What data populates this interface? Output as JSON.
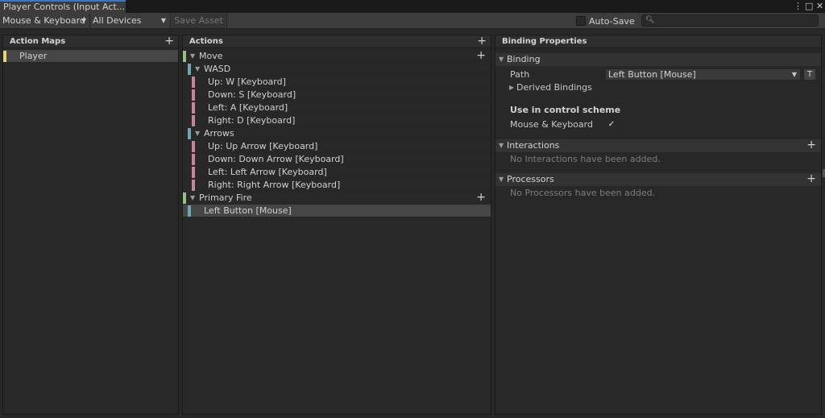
{
  "window": {
    "title": "Player Controls (Input Act...",
    "controls": [
      "⋮",
      "□",
      "✕"
    ]
  },
  "toolbar": {
    "control_scheme": "Mouse & Keyboard",
    "devices": "All Devices",
    "save_asset": "Save Asset",
    "auto_save_label": "Auto-Save",
    "search_placeholder": ""
  },
  "action_maps": {
    "header": "Action Maps",
    "items": [
      {
        "label": "Player",
        "color": "#e6d473"
      }
    ]
  },
  "actions": {
    "header": "Actions",
    "rows": [
      {
        "label": "Move",
        "kind": "action",
        "bar": "green",
        "expanded": true,
        "add": true
      },
      {
        "label": "WASD",
        "kind": "composite",
        "bar": "blue",
        "expanded": true
      },
      {
        "label": "Up: W [Keyboard]",
        "kind": "part",
        "bar": "pink"
      },
      {
        "label": "Down: S [Keyboard]",
        "kind": "part",
        "bar": "pink"
      },
      {
        "label": "Left: A [Keyboard]",
        "kind": "part",
        "bar": "pink"
      },
      {
        "label": "Right: D [Keyboard]",
        "kind": "part",
        "bar": "pink"
      },
      {
        "label": "Arrows",
        "kind": "composite",
        "bar": "blue",
        "expanded": true
      },
      {
        "label": "Up: Up Arrow [Keyboard]",
        "kind": "part",
        "bar": "pink"
      },
      {
        "label": "Down: Down Arrow [Keyboard]",
        "kind": "part",
        "bar": "pink"
      },
      {
        "label": "Left: Left Arrow [Keyboard]",
        "kind": "part",
        "bar": "pink"
      },
      {
        "label": "Right: Right Arrow [Keyboard]",
        "kind": "part",
        "bar": "pink"
      },
      {
        "label": "Primary Fire",
        "kind": "action",
        "bar": "green",
        "expanded": true,
        "add": true
      },
      {
        "label": "Left Button [Mouse]",
        "kind": "binding",
        "bar": "blue",
        "selected": true
      }
    ]
  },
  "binding_properties": {
    "header": "Binding Properties",
    "binding_section": "Binding",
    "path_label": "Path",
    "path_value": "Left Button [Mouse]",
    "t_button": "T",
    "derived_bindings": "Derived Bindings",
    "control_scheme_heading": "Use in control scheme",
    "scheme_name": "Mouse & Keyboard",
    "scheme_checked": "✓",
    "interactions_section": "Interactions",
    "interactions_empty": "No Interactions have been added.",
    "processors_section": "Processors",
    "processors_empty": "No Processors have been added."
  }
}
